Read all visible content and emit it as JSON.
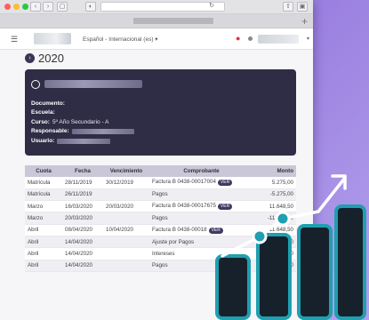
{
  "browser": {
    "url_text": "",
    "tab_title": "",
    "window_controls": [
      "close",
      "minimize",
      "maximize"
    ],
    "colors": {
      "close": "#ff5f57",
      "minimize": "#febc2e",
      "maximize": "#28c840"
    }
  },
  "appbar": {
    "language": "Español - Internacional (es) ▾",
    "user_caret": "▾"
  },
  "page": {
    "year": "2020"
  },
  "student_card": {
    "documento_label": "Documento:",
    "escuela_label": "Escuela:",
    "curso_label": "Curso:",
    "curso_value": "5º Año Secundario - A",
    "responsable_label": "Responsable:",
    "usuario_label": "Usuario:"
  },
  "table": {
    "headers": [
      "Cuota",
      "Fecha",
      "Vencimiento",
      "Comprobante",
      "Monto"
    ],
    "ver_label": "VER",
    "rows": [
      {
        "cuota": "Matrícula",
        "fecha": "28/11/2019",
        "vencimiento": "30/12/2019",
        "comprobante": "Factura B 0438-00017004",
        "ver": true,
        "monto": "5.275,00"
      },
      {
        "cuota": "Matrícula",
        "fecha": "26/11/2019",
        "vencimiento": "",
        "comprobante": "Pagos",
        "ver": false,
        "monto": "-5.275,00"
      },
      {
        "cuota": "Marzo",
        "fecha": "16/03/2020",
        "vencimiento": "20/03/2020",
        "comprobante": "Factura B 0438-00017675",
        "ver": true,
        "monto": "11.648,50"
      },
      {
        "cuota": "Marzo",
        "fecha": "20/03/2020",
        "vencimiento": "",
        "comprobante": "Pagos",
        "ver": false,
        "monto": "-11.648,50"
      },
      {
        "cuota": "Abril",
        "fecha": "08/04/2020",
        "vencimiento": "10/04/2020",
        "comprobante": "Factura B 0438-00018",
        "ver": true,
        "monto": "11.648,50"
      },
      {
        "cuota": "Abril",
        "fecha": "14/04/2020",
        "vencimiento": "",
        "comprobante": "Ajuste por Pagos",
        "ver": false,
        "monto": "…,50"
      },
      {
        "cuota": "Abril",
        "fecha": "14/04/2020",
        "vencimiento": "",
        "comprobante": "Intereses",
        "ver": false,
        "monto": "…,50"
      },
      {
        "cuota": "Abril",
        "fecha": "14/04/2020",
        "vencimiento": "",
        "comprobante": "Pagos",
        "ver": false,
        "monto": "…,50"
      }
    ]
  },
  "decoration": {
    "icon": "growth-chart-icon",
    "bar_fill": "#17212b",
    "bar_outline": "#1f9fb0",
    "line_color": "#ffffff"
  }
}
